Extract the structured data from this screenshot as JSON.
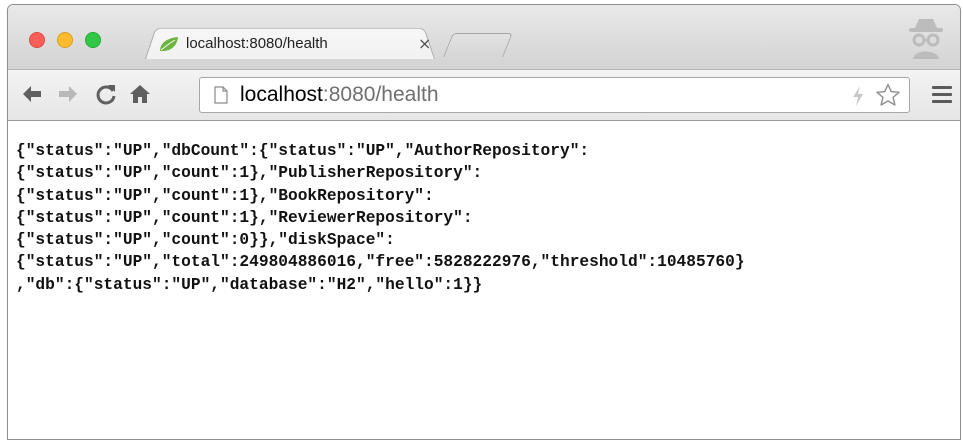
{
  "tab": {
    "title": "localhost:8080/health",
    "close_glyph": "×",
    "favicon": "spring-leaf-icon"
  },
  "omnibox": {
    "host": "localhost",
    "rest": ":8080/health"
  },
  "icons": {
    "back": "back-arrow-icon",
    "forward": "forward-arrow-icon",
    "reload": "reload-icon",
    "home": "home-icon",
    "page": "page-icon",
    "bolt": "bolt-icon",
    "star": "bookmark-star-icon",
    "menu": "hamburger-menu-icon",
    "incognito": "incognito-icon"
  },
  "colors": {
    "close": "#fc5f57",
    "minimize": "#fdbc2e",
    "zoom": "#33c748",
    "favicon_green": "#6db33f"
  },
  "page": {
    "lines": [
      "{\"status\":\"UP\",\"dbCount\":{\"status\":\"UP\",\"AuthorRepository\":",
      "{\"status\":\"UP\",\"count\":1},\"PublisherRepository\":",
      "{\"status\":\"UP\",\"count\":1},\"BookRepository\":",
      "{\"status\":\"UP\",\"count\":1},\"ReviewerRepository\":",
      "{\"status\":\"UP\",\"count\":0}},\"diskSpace\":",
      "{\"status\":\"UP\",\"total\":249804886016,\"free\":5828222976,\"threshold\":10485760}",
      ",\"db\":{\"status\":\"UP\",\"database\":\"H2\",\"hello\":1}}"
    ]
  }
}
